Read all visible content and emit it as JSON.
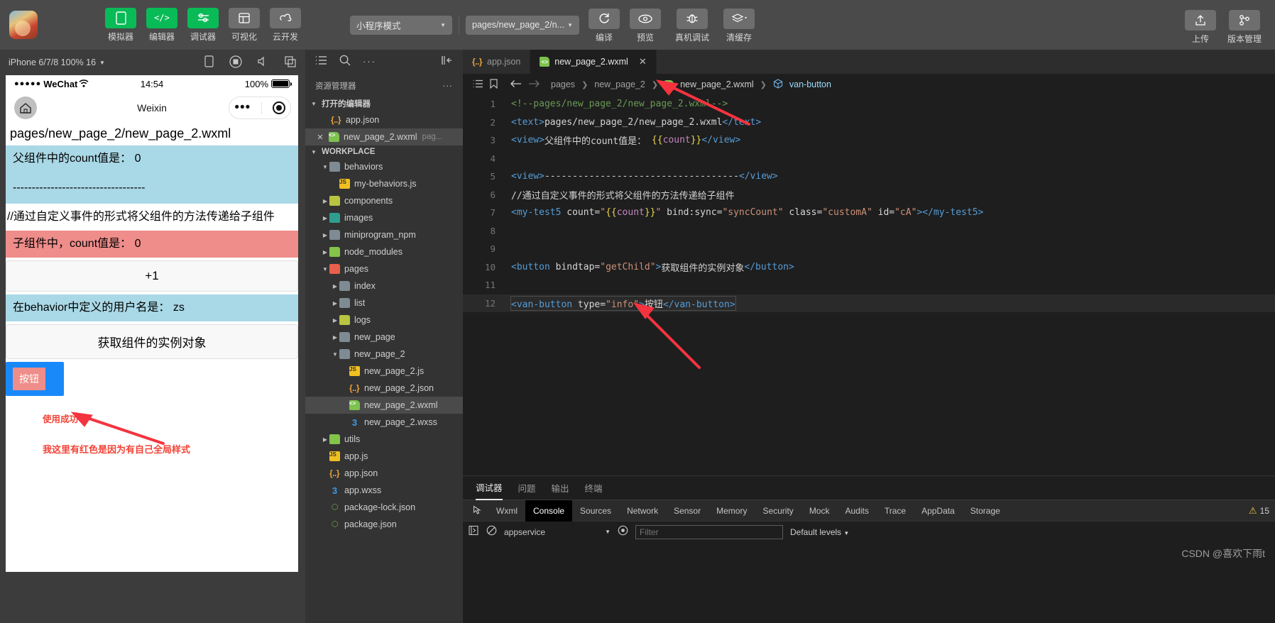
{
  "toolbar": {
    "logo_name": "app-logo",
    "items": [
      {
        "label": "模拟器",
        "icon": "phone-icon",
        "style": "green"
      },
      {
        "label": "编辑器",
        "icon": "code-icon",
        "style": "green"
      },
      {
        "label": "调试器",
        "icon": "sliders-icon",
        "style": "green"
      },
      {
        "label": "可视化",
        "icon": "layout-icon",
        "style": "grey"
      },
      {
        "label": "云开发",
        "icon": "cloud-icon",
        "style": "grey"
      }
    ],
    "mode_select": "小程序模式",
    "page_select": "pages/new_page_2/n...",
    "actions": [
      {
        "label": "编译",
        "icon": "refresh-icon"
      },
      {
        "label": "预览",
        "icon": "eye-icon"
      },
      {
        "label": "真机调试",
        "icon": "bug-icon"
      },
      {
        "label": "清缓存",
        "icon": "layers-icon"
      }
    ],
    "right_actions": [
      {
        "label": "上传",
        "icon": "upload-icon"
      },
      {
        "label": "版本管理",
        "icon": "branch-icon"
      }
    ]
  },
  "simulator": {
    "device_label": "iPhone 6/7/8 100% 16",
    "icons": [
      "phone-icon",
      "record-icon",
      "mute-icon",
      "copy-icon"
    ],
    "status": {
      "carrier": "WeChat",
      "signal": "●●●●●",
      "time": "14:54",
      "battery": "100%"
    },
    "nav": {
      "home": "home-icon",
      "title": "Weixin",
      "menu_dots": "more-dots-icon",
      "target": "target-icon"
    },
    "page_title": "pages/new_page_2/new_page_2.wxml",
    "rows": [
      {
        "text": "父组件中的count值是： 0",
        "style": "blue"
      },
      {
        "text": "-----------------------------------",
        "style": "blue"
      },
      {
        "text": "//通过自定义事件的形式将父组件的方法传递给子组件",
        "style": "plain"
      },
      {
        "text": "子组件中，count值是： 0",
        "style": "red"
      },
      {
        "text": "+1",
        "style": "button"
      },
      {
        "text": "在behavior中定义的用户名是： zs",
        "style": "blue"
      },
      {
        "text": "获取组件的实例对象",
        "style": "button"
      }
    ],
    "van_button": "按钮",
    "annotation_1": "使用成功",
    "annotation_2": "我这里有红色是因为有自己全局样式"
  },
  "explorer": {
    "toolbar_icons": [
      "list-icon",
      "search-icon",
      "more-icon",
      "collapse-icon"
    ],
    "title": "资源管理器",
    "title_more": "...",
    "open_editors": {
      "label": "打开的编辑器",
      "items": [
        {
          "name": "app.json",
          "icon": "json-icon",
          "sub": "",
          "closable": false,
          "selected": false
        },
        {
          "name": "new_page_2.wxml",
          "icon": "wxml-icon",
          "sub": "pag...",
          "closable": true,
          "selected": true
        }
      ]
    },
    "workplace": {
      "label": "WORKPLACE",
      "tree": [
        {
          "name": "behaviors",
          "icon": "folder-grey",
          "depth": 1,
          "twisty": "open"
        },
        {
          "name": "my-behaviors.js",
          "icon": "js-icon",
          "depth": 2,
          "twisty": ""
        },
        {
          "name": "components",
          "icon": "folder-olive",
          "depth": 1,
          "twisty": "closed"
        },
        {
          "name": "images",
          "icon": "folder-teal",
          "depth": 1,
          "twisty": "closed"
        },
        {
          "name": "miniprogram_npm",
          "icon": "folder-grey",
          "depth": 1,
          "twisty": "closed"
        },
        {
          "name": "node_modules",
          "icon": "folder-green",
          "depth": 1,
          "twisty": "closed"
        },
        {
          "name": "pages",
          "icon": "folder-red",
          "depth": 1,
          "twisty": "open"
        },
        {
          "name": "index",
          "icon": "folder-grey",
          "depth": 2,
          "twisty": "closed"
        },
        {
          "name": "list",
          "icon": "folder-grey",
          "depth": 2,
          "twisty": "closed"
        },
        {
          "name": "logs",
          "icon": "folder-olive",
          "depth": 2,
          "twisty": "closed"
        },
        {
          "name": "new_page",
          "icon": "folder-grey",
          "depth": 2,
          "twisty": "closed"
        },
        {
          "name": "new_page_2",
          "icon": "folder-open",
          "depth": 2,
          "twisty": "open"
        },
        {
          "name": "new_page_2.js",
          "icon": "js-icon",
          "depth": 3,
          "twisty": ""
        },
        {
          "name": "new_page_2.json",
          "icon": "json-icon",
          "depth": 3,
          "twisty": ""
        },
        {
          "name": "new_page_2.wxml",
          "icon": "wxml-icon",
          "depth": 3,
          "twisty": "",
          "selected": true
        },
        {
          "name": "new_page_2.wxss",
          "icon": "wxss-icon",
          "depth": 3,
          "twisty": ""
        },
        {
          "name": "utils",
          "icon": "folder-green",
          "depth": 1,
          "twisty": "closed"
        },
        {
          "name": "app.js",
          "icon": "js-icon",
          "depth": 1,
          "twisty": ""
        },
        {
          "name": "app.json",
          "icon": "json-icon",
          "depth": 1,
          "twisty": ""
        },
        {
          "name": "app.wxss",
          "icon": "wxss-icon",
          "depth": 1,
          "twisty": ""
        },
        {
          "name": "package-lock.json",
          "icon": "node-icon",
          "depth": 1,
          "twisty": ""
        },
        {
          "name": "package.json",
          "icon": "node-icon",
          "depth": 1,
          "twisty": ""
        }
      ]
    }
  },
  "editor": {
    "tabs": [
      {
        "label": "app.json",
        "icon": "json-icon",
        "active": false,
        "closable": false
      },
      {
        "label": "new_page_2.wxml",
        "icon": "wxml-icon",
        "active": true,
        "closable": true
      }
    ],
    "breadcrumb": [
      "pages",
      "new_page_2",
      "new_page_2.wxml",
      "van-button"
    ],
    "breadcrumb_icons": [
      "list-icon",
      "bookmark-icon",
      "back-arrow-icon",
      "forward-arrow-icon"
    ],
    "lines": [
      {
        "n": "1",
        "segments": [
          {
            "t": "<!--pages/new_page_2/new_page_2.wxml-->",
            "c": "cmt"
          }
        ]
      },
      {
        "n": "2",
        "segments": [
          {
            "t": "<text>",
            "c": "tag"
          },
          {
            "t": "pages/new_page_2/new_page_2.wxml",
            "c": "txt"
          },
          {
            "t": "</text>",
            "c": "tag"
          }
        ]
      },
      {
        "n": "3",
        "segments": [
          {
            "t": "<view>",
            "c": "tag"
          },
          {
            "t": "父组件中的count值是：",
            "c": "txt"
          },
          {
            "t": " {{",
            "c": "brace"
          },
          {
            "t": "count",
            "c": "mus"
          },
          {
            "t": "}}",
            "c": "brace"
          },
          {
            "t": "</view>",
            "c": "tag"
          }
        ]
      },
      {
        "n": "4",
        "segments": []
      },
      {
        "n": "5",
        "segments": [
          {
            "t": "<view>",
            "c": "tag"
          },
          {
            "t": "-----------------------------------",
            "c": "txt"
          },
          {
            "t": "</view>",
            "c": "tag"
          }
        ]
      },
      {
        "n": "6",
        "segments": [
          {
            "t": "//通过自定义事件的形式将父组件的方法传递给子组件",
            "c": "txt"
          }
        ]
      },
      {
        "n": "7",
        "segments": [
          {
            "t": "<my-test5",
            "c": "tag"
          },
          {
            "t": " count=",
            "c": "attr"
          },
          {
            "t": "\"",
            "c": "str"
          },
          {
            "t": "{{",
            "c": "brace"
          },
          {
            "t": "count",
            "c": "mus"
          },
          {
            "t": "}}",
            "c": "brace"
          },
          {
            "t": "\"",
            "c": "str"
          },
          {
            "t": " bind:sync=",
            "c": "attr"
          },
          {
            "t": "\"syncCount\"",
            "c": "str"
          },
          {
            "t": " class=",
            "c": "attr"
          },
          {
            "t": "\"customA\"",
            "c": "str"
          },
          {
            "t": " id=",
            "c": "attr"
          },
          {
            "t": "\"cA\"",
            "c": "str"
          },
          {
            "t": ">",
            "c": "tag"
          },
          {
            "t": "</my-test5>",
            "c": "tag"
          }
        ]
      },
      {
        "n": "8",
        "segments": []
      },
      {
        "n": "9",
        "segments": []
      },
      {
        "n": "10",
        "segments": [
          {
            "t": "<button",
            "c": "tag"
          },
          {
            "t": " bindtap=",
            "c": "attr"
          },
          {
            "t": "\"getChild\"",
            "c": "str"
          },
          {
            "t": ">",
            "c": "tag"
          },
          {
            "t": "获取组件的实例对象",
            "c": "txt"
          },
          {
            "t": "</button>",
            "c": "tag"
          }
        ]
      },
      {
        "n": "11",
        "segments": []
      },
      {
        "n": "12",
        "highlight": true,
        "segments": [
          {
            "t": "<van-button",
            "c": "tag"
          },
          {
            "t": " type=",
            "c": "attr"
          },
          {
            "t": "\"info\"",
            "c": "str"
          },
          {
            "t": ">",
            "c": "tag"
          },
          {
            "t": "按钮",
            "c": "txt"
          },
          {
            "t": "</van-button>",
            "c": "tag"
          }
        ]
      }
    ]
  },
  "console": {
    "panel_tabs": [
      {
        "label": "调试器",
        "active": true
      },
      {
        "label": "问题",
        "active": false
      },
      {
        "label": "输出",
        "active": false
      },
      {
        "label": "终端",
        "active": false
      }
    ],
    "devtool_tabs": [
      {
        "label": "Wxml",
        "active": false
      },
      {
        "label": "Console",
        "active": true
      },
      {
        "label": "Sources",
        "active": false
      },
      {
        "label": "Network",
        "active": false
      },
      {
        "label": "Sensor",
        "active": false
      },
      {
        "label": "Memory",
        "active": false
      },
      {
        "label": "Security",
        "active": false
      },
      {
        "label": "Mock",
        "active": false
      },
      {
        "label": "Audits",
        "active": false
      },
      {
        "label": "Trace",
        "active": false
      },
      {
        "label": "AppData",
        "active": false
      },
      {
        "label": "Storage",
        "active": false
      }
    ],
    "warning_count": "15",
    "context": "appservice",
    "filter_placeholder": "Filter",
    "levels": "Default levels",
    "watermark": "CSDN @喜欢下雨t"
  },
  "colors": {
    "green": "#09bb57",
    "blue_row": "#a9d8e6",
    "red_row": "#ee8d8a",
    "van_blue": "#1989fa",
    "annotation_red": "#f44336"
  }
}
